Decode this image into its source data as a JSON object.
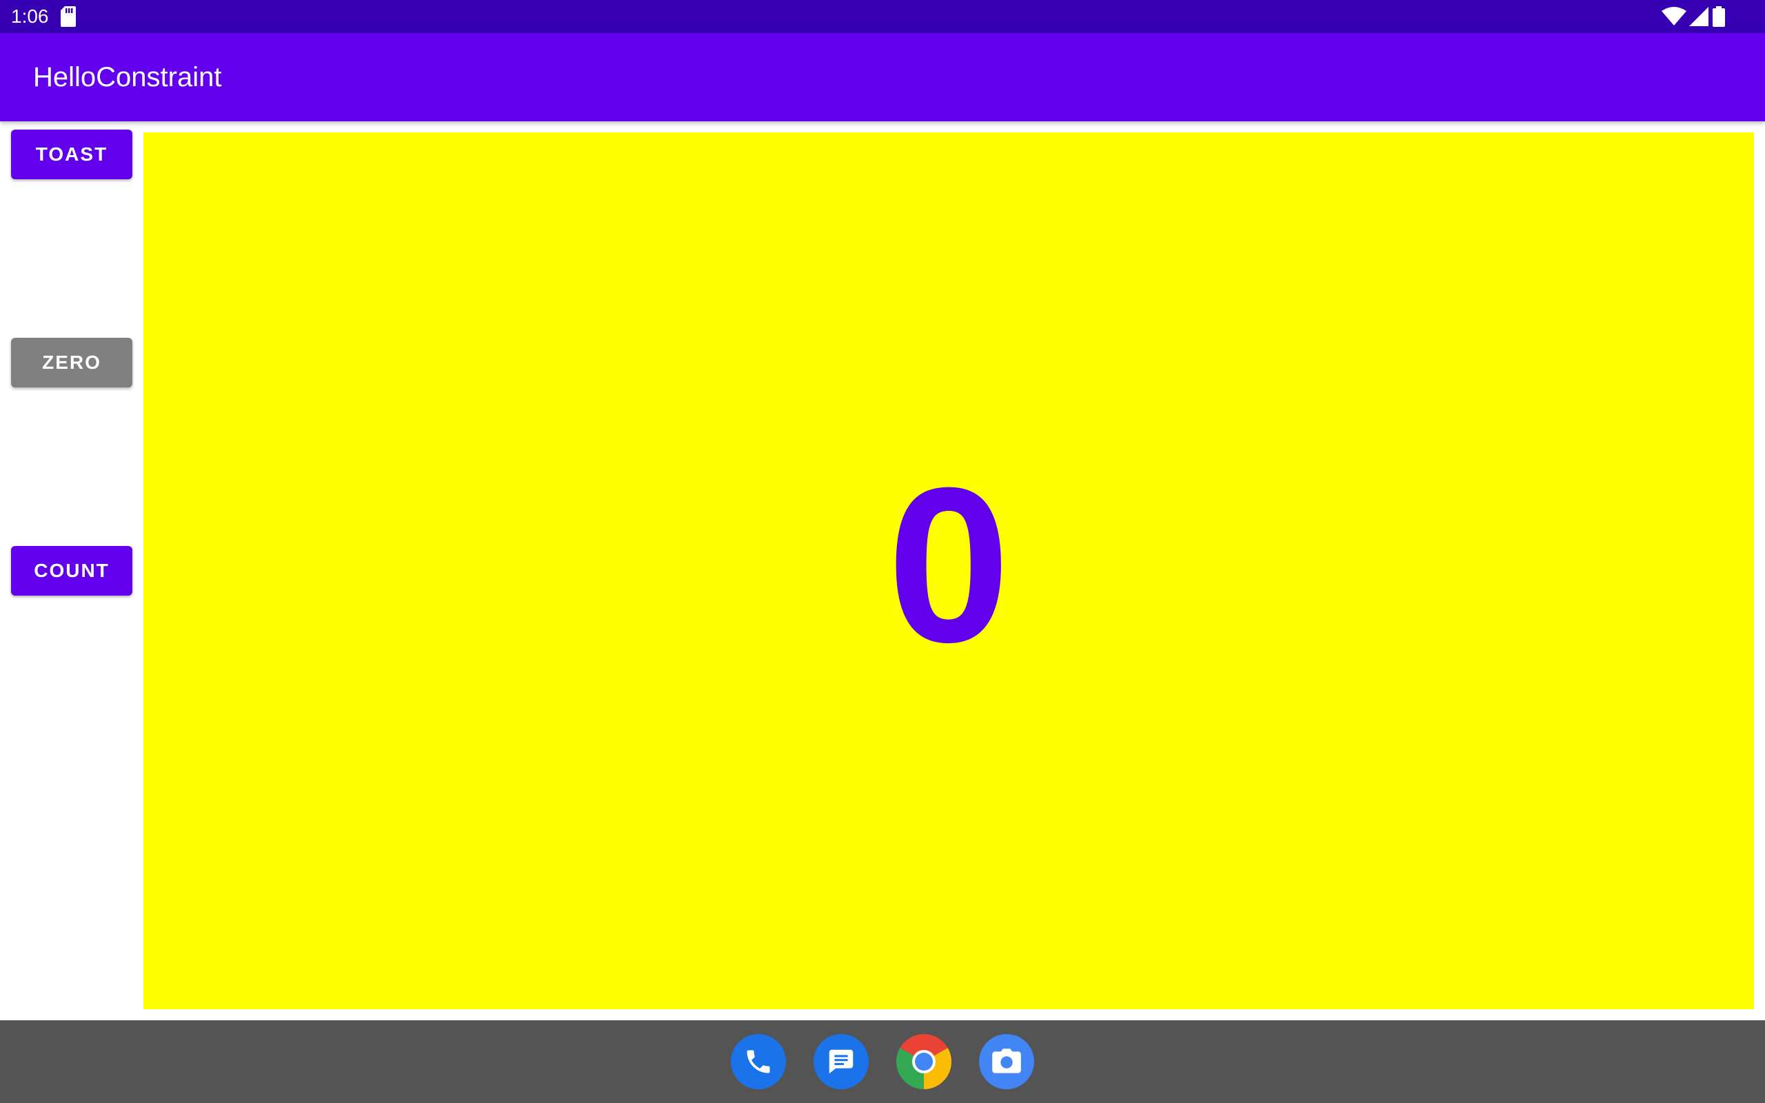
{
  "status_bar": {
    "time": "1:06",
    "icons": [
      "sd-card-icon",
      "wifi-icon",
      "signal-icon",
      "battery-icon"
    ]
  },
  "app_bar": {
    "title": "HelloConstraint"
  },
  "buttons": {
    "toast": "TOAST",
    "zero": "ZERO",
    "count": "COUNT"
  },
  "counter": {
    "value": "0"
  },
  "colors": {
    "primary": "#6200EE",
    "primary_dark": "#3700B3",
    "panel_background": "#FFFF00",
    "zero_button": "#808080",
    "nav_bar": "#545454"
  },
  "dock": {
    "apps": [
      "phone-icon",
      "messages-icon",
      "chrome-icon",
      "camera-icon"
    ]
  }
}
